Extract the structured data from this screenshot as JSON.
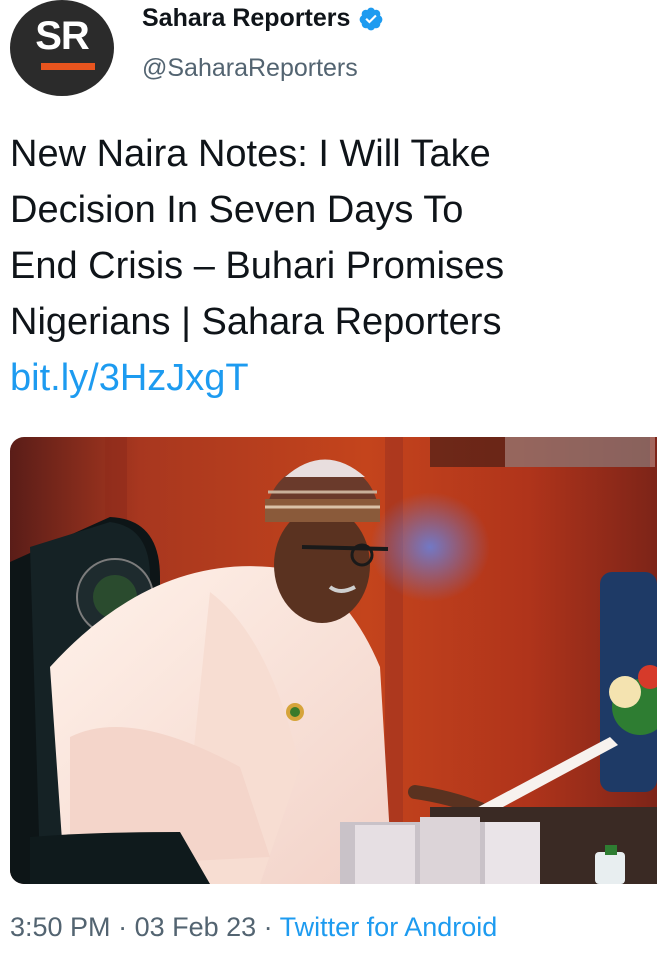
{
  "author": {
    "avatar_initials": "SR",
    "display_name": "Sahara Reporters",
    "handle": "@SaharaReporters",
    "verified_icon": "verified-badge-icon"
  },
  "tweet": {
    "text_lines": [
      "New Naira Notes: I Will Take",
      "Decision In Seven Days To",
      "End Crisis – Buhari Promises",
      "Nigerians | Sahara Reporters"
    ],
    "link": "bit.ly/3HzJxgT"
  },
  "meta": {
    "time": "3:50 PM",
    "separator": " · ",
    "date": "03 Feb 23",
    "separator2": " · ",
    "source": "Twitter for Android"
  },
  "colors": {
    "link": "#1d9bf0",
    "secondary_text": "#536471",
    "avatar_bg": "#2b2b2b",
    "avatar_bar": "#e8541e"
  }
}
